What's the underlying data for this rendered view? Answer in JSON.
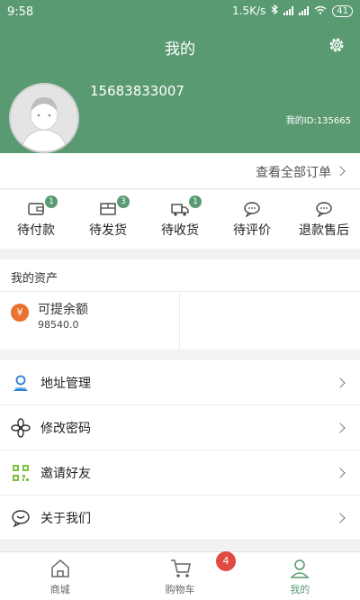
{
  "status_bar": {
    "time": "9:58",
    "network_speed": "1.5K/s",
    "battery": "41"
  },
  "header": {
    "title": "我的",
    "phone": "15683833007",
    "user_id": "我的ID:135665"
  },
  "orders": {
    "view_all": "查看全部订单",
    "tabs": [
      {
        "label": "待付款",
        "badge": "1",
        "icon": "wallet-icon"
      },
      {
        "label": "待发货",
        "badge": "3",
        "icon": "box-icon"
      },
      {
        "label": "待收货",
        "badge": "1",
        "icon": "truck-icon"
      },
      {
        "label": "待评价",
        "badge": "",
        "icon": "comment-icon"
      },
      {
        "label": "退款售后",
        "badge": "",
        "icon": "refund-icon"
      }
    ]
  },
  "assets": {
    "title": "我的资产",
    "balance_label": "可提余额",
    "balance_value": "98540.0",
    "coin_symbol": "¥"
  },
  "menu": {
    "items": [
      {
        "label": "地址管理",
        "icon": "location-person-icon"
      },
      {
        "label": "修改密码",
        "icon": "flower-icon"
      },
      {
        "label": "邀请好友",
        "icon": "qr-code-icon"
      },
      {
        "label": "关于我们",
        "icon": "chat-icon"
      }
    ]
  },
  "tabbar": {
    "items": [
      {
        "label": "商城",
        "icon": "home-icon"
      },
      {
        "label": "购物车",
        "icon": "cart-icon",
        "badge": "4"
      },
      {
        "label": "我的",
        "icon": "person-icon",
        "active": true
      }
    ]
  },
  "colors": {
    "primary": "#5a9a72",
    "badge_red": "#e04a40",
    "coin_orange": "#e9722f"
  }
}
